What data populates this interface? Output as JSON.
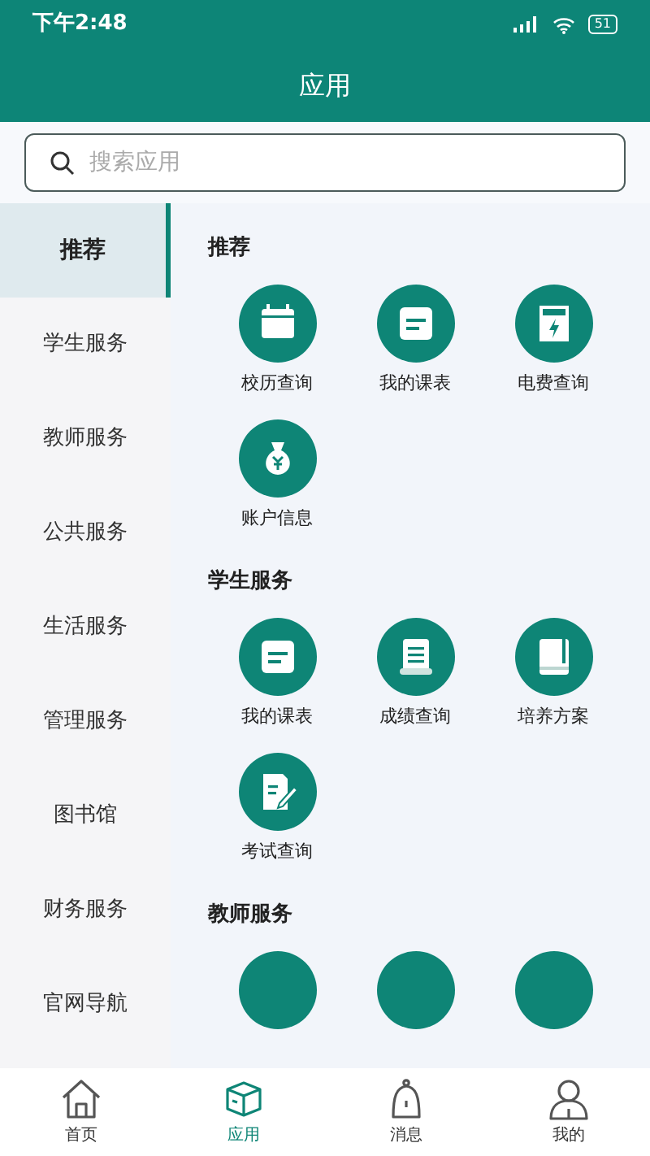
{
  "status_bar": {
    "time": "下午2:48",
    "battery": "51"
  },
  "header": {
    "title": "应用"
  },
  "search": {
    "placeholder": "搜索应用"
  },
  "sidebar": {
    "items": [
      {
        "label": "推荐",
        "selected": true
      },
      {
        "label": "学生服务",
        "selected": false
      },
      {
        "label": "教师服务",
        "selected": false
      },
      {
        "label": "公共服务",
        "selected": false
      },
      {
        "label": "生活服务",
        "selected": false
      },
      {
        "label": "管理服务",
        "selected": false
      },
      {
        "label": "图书馆",
        "selected": false
      },
      {
        "label": "财务服务",
        "selected": false
      },
      {
        "label": "官网导航",
        "selected": false
      }
    ]
  },
  "sections": [
    {
      "title": "推荐",
      "items": [
        {
          "kind": "calendar",
          "label": "校历查询"
        },
        {
          "kind": "note",
          "label": "我的课表"
        },
        {
          "kind": "meter",
          "label": "电费查询"
        },
        {
          "kind": "moneybag",
          "label": "账户信息"
        }
      ]
    },
    {
      "title": "学生服务",
      "items": [
        {
          "kind": "note",
          "label": "我的课表"
        },
        {
          "kind": "scroll",
          "label": "成绩查询"
        },
        {
          "kind": "book",
          "label": "培养方案"
        },
        {
          "kind": "edit",
          "label": "考试查询"
        }
      ]
    },
    {
      "title": "教师服务",
      "items": [
        {
          "kind": "partial"
        },
        {
          "kind": "partial"
        },
        {
          "kind": "partial"
        }
      ]
    }
  ],
  "tabbar": [
    {
      "kind": "home",
      "label": "首页",
      "selected": false
    },
    {
      "kind": "box",
      "label": "应用",
      "selected": true
    },
    {
      "kind": "bell",
      "label": "消息",
      "selected": false
    },
    {
      "kind": "person",
      "label": "我的",
      "selected": false
    }
  ]
}
